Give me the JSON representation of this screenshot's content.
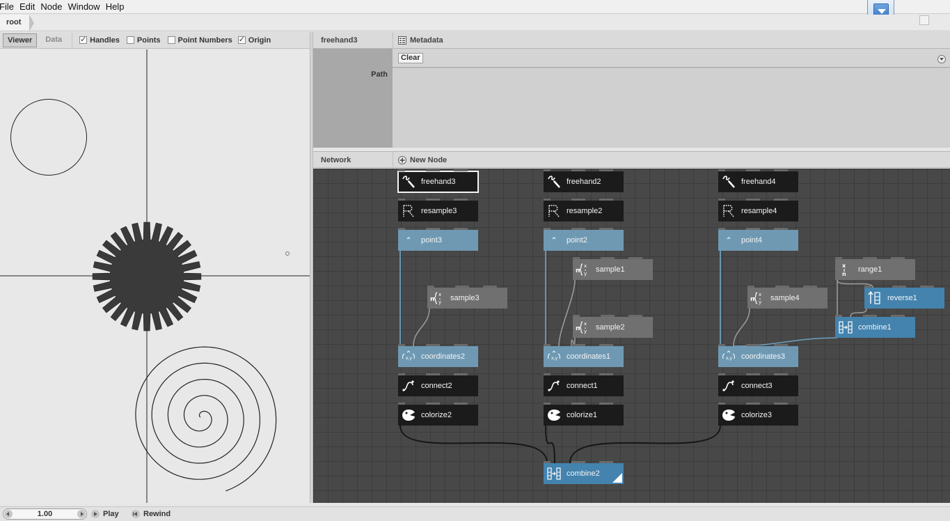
{
  "menubar": {
    "items": [
      "File",
      "Edit",
      "Node",
      "Window",
      "Help"
    ]
  },
  "address": {
    "crumb": "root"
  },
  "viewer": {
    "tabs": [
      "Viewer",
      "Data"
    ],
    "checkboxes": [
      {
        "label": "Handles",
        "checked": true
      },
      {
        "label": "Points",
        "checked": false
      },
      {
        "label": "Point Numbers",
        "checked": false
      },
      {
        "label": "Origin",
        "checked": true
      }
    ]
  },
  "params": {
    "node_name": "freehand3",
    "metadata_label": "Metadata",
    "path_label": "Path",
    "clear_label": "Clear"
  },
  "network": {
    "title": "Network",
    "new_node_label": "New Node",
    "nodes": [
      {
        "id": "freehand3",
        "label": "freehand3",
        "kind": "dark",
        "icon": "freehand-icon",
        "selected": true
      },
      {
        "id": "resample3",
        "label": "resample3",
        "kind": "dark",
        "icon": "resample-icon"
      },
      {
        "id": "point3",
        "label": "point3",
        "kind": "lightblue",
        "icon": "point-icon"
      },
      {
        "id": "sample3",
        "label": "sample3",
        "kind": "gray",
        "icon": "sample-icon"
      },
      {
        "id": "coordinates2",
        "label": "coordinates2",
        "kind": "lightblue",
        "icon": "coordinates-icon"
      },
      {
        "id": "connect2",
        "label": "connect2",
        "kind": "dark",
        "icon": "connect-icon"
      },
      {
        "id": "colorize2",
        "label": "colorize2",
        "kind": "dark",
        "icon": "colorize-icon"
      },
      {
        "id": "freehand2",
        "label": "freehand2",
        "kind": "dark",
        "icon": "freehand-icon"
      },
      {
        "id": "resample2",
        "label": "resample2",
        "kind": "dark",
        "icon": "resample-icon"
      },
      {
        "id": "point2",
        "label": "point2",
        "kind": "lightblue",
        "icon": "point-icon"
      },
      {
        "id": "sample1",
        "label": "sample1",
        "kind": "gray",
        "icon": "sample-icon"
      },
      {
        "id": "sample2",
        "label": "sample2",
        "kind": "gray",
        "icon": "sample-icon"
      },
      {
        "id": "coordinates1",
        "label": "coordinates1",
        "kind": "lightblue",
        "icon": "coordinates-icon"
      },
      {
        "id": "connect1",
        "label": "connect1",
        "kind": "dark",
        "icon": "connect-icon"
      },
      {
        "id": "colorize1",
        "label": "colorize1",
        "kind": "dark",
        "icon": "colorize-icon"
      },
      {
        "id": "combine2",
        "label": "combine2",
        "kind": "blue",
        "icon": "combine-icon",
        "rendered": true
      },
      {
        "id": "freehand4",
        "label": "freehand4",
        "kind": "dark",
        "icon": "freehand-icon"
      },
      {
        "id": "resample4",
        "label": "resample4",
        "kind": "dark",
        "icon": "resample-icon"
      },
      {
        "id": "point4",
        "label": "point4",
        "kind": "lightblue",
        "icon": "point-icon"
      },
      {
        "id": "sample4",
        "label": "sample4",
        "kind": "gray",
        "icon": "sample-icon"
      },
      {
        "id": "coordinates3",
        "label": "coordinates3",
        "kind": "lightblue",
        "icon": "coordinates-icon"
      },
      {
        "id": "connect3",
        "label": "connect3",
        "kind": "dark",
        "icon": "connect-icon"
      },
      {
        "id": "colorize3",
        "label": "colorize3",
        "kind": "dark",
        "icon": "colorize-icon"
      },
      {
        "id": "range1",
        "label": "range1",
        "kind": "gray",
        "icon": "range-icon"
      },
      {
        "id": "reverse1",
        "label": "reverse1",
        "kind": "blue",
        "icon": "reverse-icon"
      },
      {
        "id": "combine1",
        "label": "combine1",
        "kind": "blue",
        "icon": "combine-icon"
      }
    ],
    "connections": [
      [
        "point3",
        "coordinates2"
      ],
      [
        "sample3",
        "coordinates2"
      ],
      [
        "point2",
        "coordinates1"
      ],
      [
        "sample1",
        "coordinates1"
      ],
      [
        "sample2",
        "coordinates1"
      ],
      [
        "point4",
        "coordinates3"
      ],
      [
        "sample4",
        "coordinates3"
      ],
      [
        "range1",
        "combine1"
      ],
      [
        "range1",
        "reverse1"
      ],
      [
        "reverse1",
        "combine1"
      ],
      [
        "combine1",
        "coordinates3"
      ],
      [
        "colorize2",
        "combine2"
      ],
      [
        "colorize1",
        "combine2"
      ],
      [
        "colorize3",
        "combine2"
      ]
    ]
  },
  "colors": {
    "dark": "#1b1b1b",
    "gray": "#707070",
    "lightblue": "#6f99b3",
    "blue": "#4383ae",
    "wire_blue": "#6e9fbf",
    "wire_gray": "#999999",
    "wire_dark": "#161616"
  },
  "footer": {
    "frame": "1.00",
    "play_label": "Play",
    "rewind_label": "Rewind"
  }
}
